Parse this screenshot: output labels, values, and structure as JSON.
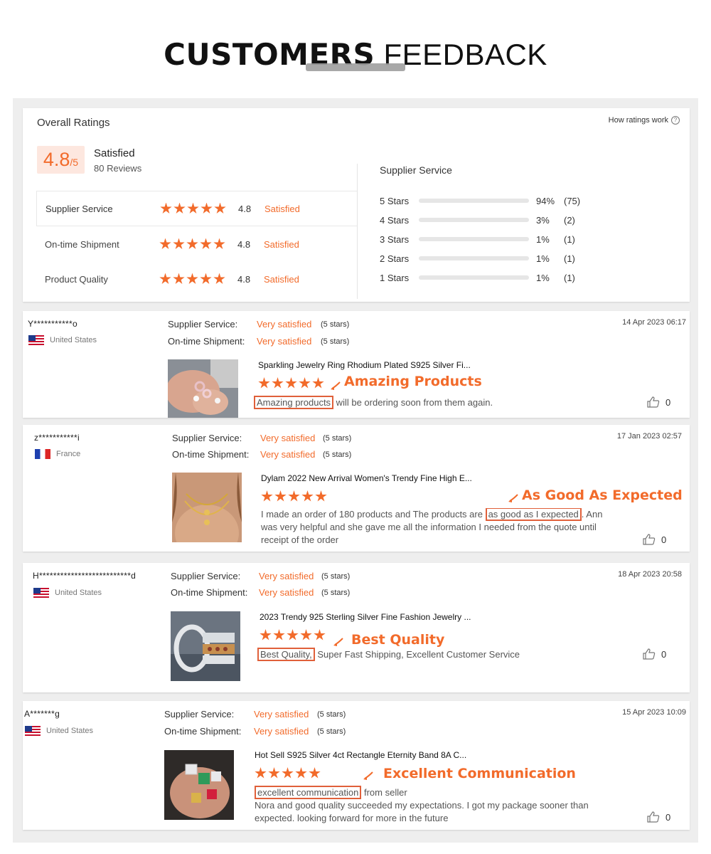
{
  "header": {
    "title_bold": "CUSTOMERS",
    "title_light": "FEEDBACK"
  },
  "overall": {
    "title": "Overall Ratings",
    "how_link": "How ratings work",
    "score": "4.8",
    "score_suffix": "/5",
    "score_label": "Satisfied",
    "reviews": "80 Reviews",
    "rows": [
      {
        "name": "Supplier Service",
        "value": "4.8",
        "status": "Satisfied",
        "stars": 5
      },
      {
        "name": "On-time Shipment",
        "value": "4.8",
        "status": "Satisfied",
        "stars": 5
      },
      {
        "name": "Product Quality",
        "value": "4.8",
        "status": "Satisfied",
        "stars": 5
      }
    ],
    "supplier_title": "Supplier Service",
    "distribution": [
      {
        "label": "5  Stars",
        "pct": "94%",
        "count": "(75)",
        "fraction": 0.94
      },
      {
        "label": "4  Stars",
        "pct": "3%",
        "count": "(2)",
        "fraction": 0.03
      },
      {
        "label": "3  Stars",
        "pct": "1%",
        "count": "(1)",
        "fraction": 0.01
      },
      {
        "label": "2  Stars",
        "pct": "1%",
        "count": "(1)",
        "fraction": 0.01
      },
      {
        "label": "1  Stars",
        "pct": "1%",
        "count": "(1)",
        "fraction": 0.01
      }
    ],
    "accent": "#f26b2b"
  },
  "reviews": [
    {
      "user": "Y***********o",
      "country": "United States",
      "service_key": "Supplier Service:",
      "service_val": "Very satisfied",
      "service_stars": "(5 stars)",
      "ship_key": "On-time Shipment:",
      "ship_val": "Very satisfied",
      "ship_stars": "(5 stars)",
      "date": "14 Apr 2023 06:17",
      "product": "Sparkling Jewelry Ring Rhodium Plated S925 Silver Fi...",
      "callout": "Amazing Products",
      "text_hl": "Amazing products",
      "text_rest": " will be ordering soon from them again.",
      "likes": "0"
    },
    {
      "user": "z***********i",
      "country": "France",
      "service_key": "Supplier Service:",
      "service_val": "Very satisfied",
      "service_stars": "(5 stars)",
      "ship_key": "On-time Shipment:",
      "ship_val": "Very satisfied",
      "ship_stars": "(5 stars)",
      "date": "17 Jan 2023 02:57",
      "product": "Dylam 2022 New Arrival Women's Trendy Fine High E...",
      "callout": "As Good As Expected",
      "text_pre": "I made an order of 180 products and The products are ",
      "text_hl": "as good as I expected",
      "text_rest": ". Ann was very helpful and she gave me all the information I needed from the quote until receipt of the order",
      "likes": "0"
    },
    {
      "user": "H**************************d",
      "country": "United States",
      "service_key": "Supplier Service:",
      "service_val": "Very satisfied",
      "service_stars": "(5 stars)",
      "ship_key": "On-time Shipment:",
      "ship_val": "Very satisfied",
      "ship_stars": "(5 stars)",
      "date": "18 Apr 2023 20:58",
      "product": "2023 Trendy 925 Sterling Silver Fine Fashion Jewelry ...",
      "callout": "Best Quality",
      "text_hl": "Best Quality,",
      "text_rest": " Super Fast Shipping, Excellent Customer Service",
      "likes": "0"
    },
    {
      "user": "A*******g",
      "country": "United States",
      "service_key": "Supplier Service:",
      "service_val": "Very satisfied",
      "service_stars": "(5 stars)",
      "ship_key": "On-time Shipment:",
      "ship_val": "Very satisfied",
      "ship_stars": "(5 stars)",
      "date": "15 Apr 2023 10:09",
      "product": "Hot Sell S925 Silver 4ct Rectangle Eternity Band 8A C...",
      "callout": "Excellent Communication",
      "text_hl": "excellent communication",
      "text_rest": " from seller",
      "text_line2": "Nora and good quality succeeded my expectations. I got my package sooner than expected. looking forward for more in the future",
      "likes": "0"
    }
  ]
}
